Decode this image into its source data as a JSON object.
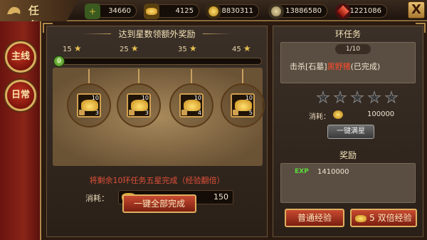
{
  "header": {
    "title": "任 务",
    "resources": [
      {
        "icon": "gold-plus-icon",
        "value": "34660"
      },
      {
        "icon": "gold-ingot-icon",
        "value": "4125"
      },
      {
        "icon": "coin-icon",
        "value": "8830311"
      },
      {
        "icon": "silver-coin-icon",
        "value": "13886580"
      },
      {
        "icon": "gem-icon",
        "value": "1221086"
      }
    ],
    "close_label": "X"
  },
  "sidebar": {
    "tabs": [
      {
        "label": "主线"
      },
      {
        "label": "日常"
      }
    ]
  },
  "star_rewards": {
    "title": "达到星数领额外奖励",
    "milestones": [
      {
        "stars": "15"
      },
      {
        "stars": "25"
      },
      {
        "stars": "35"
      },
      {
        "stars": "45"
      }
    ],
    "progress_value": "0",
    "progress_fraction": 0.0,
    "chests": [
      {
        "qty": "10",
        "count": "3"
      },
      {
        "qty": "10",
        "count": "3"
      },
      {
        "qty": "10",
        "count": "4"
      },
      {
        "qty": "10",
        "count": "5"
      }
    ],
    "note": "将剩余10环任务五星完成（经验翻倍）",
    "cost_label": "消耗：",
    "cost_value": "150",
    "complete_all_button": "一键全部完成"
  },
  "ring_quest": {
    "title": "环任务",
    "counter": "1/10",
    "task_prefix": "击杀[石墓]",
    "task_target": "黑野猪",
    "task_suffix": "(已完成)",
    "stars_filled": 0,
    "stars_total": 5,
    "cost_label": "消耗：",
    "cost_value": "100000",
    "full_star_button": "一键满星"
  },
  "rewards": {
    "title": "奖励",
    "exp_label": "EXP",
    "exp_value": "1410000",
    "normal_button": "普通经验",
    "double_cost": "5",
    "double_button": "双倍经验"
  },
  "colors": {
    "accent_gold": "#d8b060",
    "button_red": "#c84a30",
    "highlight_red": "#ff4a2a",
    "exp_green": "#5adc3a"
  }
}
